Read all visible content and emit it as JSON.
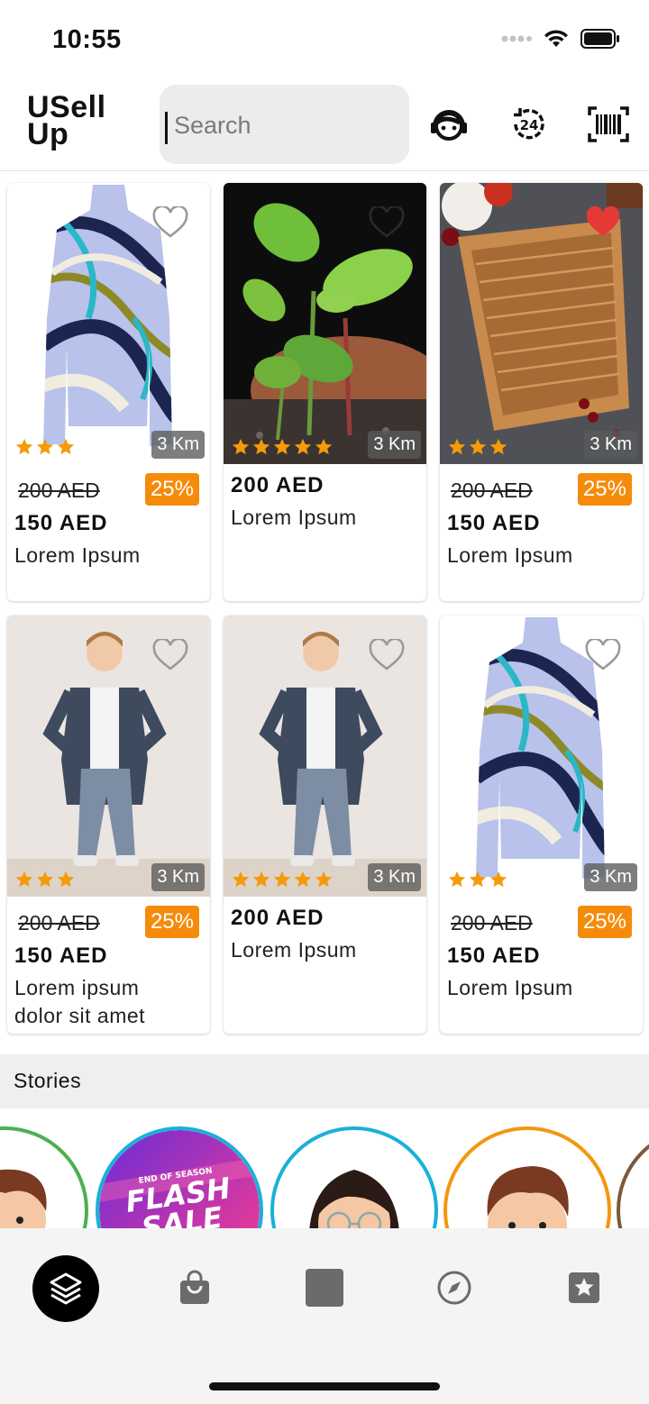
{
  "status_bar": {
    "time": "10:55"
  },
  "header": {
    "logo_line1": "USell",
    "logo_line2": "Up",
    "search_placeholder": "Search"
  },
  "products": [
    {
      "image": "patterned-turtleneck",
      "km": "3 Km",
      "rating": 3,
      "old_price": "200 AED",
      "discount": "25%",
      "price": "150 AED",
      "name": "Lorem Ipsum",
      "favorite": false
    },
    {
      "image": "plant-seedling",
      "km": "3 Km",
      "rating": 5,
      "old_price": "",
      "discount": "",
      "price": "200 AED",
      "name": "Lorem Ipsum",
      "favorite": false
    },
    {
      "image": "wicker-basket",
      "km": "3 Km",
      "rating": 3,
      "old_price": "200 AED",
      "discount": "25%",
      "price": "150 AED",
      "name": "Lorem Ipsum",
      "favorite": true
    },
    {
      "image": "boy-denim-jacket",
      "km": "3 Km",
      "rating": 3,
      "old_price": "200 AED",
      "discount": "25%",
      "price": "150 AED",
      "name": "Lorem ipsum dolor sit amet",
      "favorite": false
    },
    {
      "image": "boy-denim-jacket",
      "km": "3 Km",
      "rating": 5,
      "old_price": "",
      "discount": "",
      "price": "200 AED",
      "name": "Lorem Ipsum",
      "favorite": false
    },
    {
      "image": "patterned-turtleneck",
      "km": "3 Km",
      "rating": 3,
      "old_price": "200 AED",
      "discount": "25%",
      "price": "150 AED",
      "name": "Lorem Ipsum",
      "favorite": false
    }
  ],
  "stories": {
    "title": "Stories",
    "items": [
      {
        "avatar": "man-avatar",
        "ring": "#4caf50"
      },
      {
        "avatar": "flash-sale-banner",
        "ring": "#1ab0d8",
        "line1": "END OF SEASON",
        "line2": "FLASH",
        "line3": "SALE"
      },
      {
        "avatar": "woman-avatar",
        "ring": "#1ab0d8"
      },
      {
        "avatar": "man-avatar",
        "ring": "#f5960f"
      },
      {
        "avatar": "partial-avatar",
        "ring": "#7a5a3a"
      }
    ]
  },
  "bottom_nav": [
    "layers-icon",
    "shopping-bag-icon",
    "square-icon",
    "compass-icon",
    "star-badge-icon"
  ],
  "colors": {
    "accent": "#f58b0b",
    "star": "#f59a0a",
    "heart_active": "#e53935"
  }
}
